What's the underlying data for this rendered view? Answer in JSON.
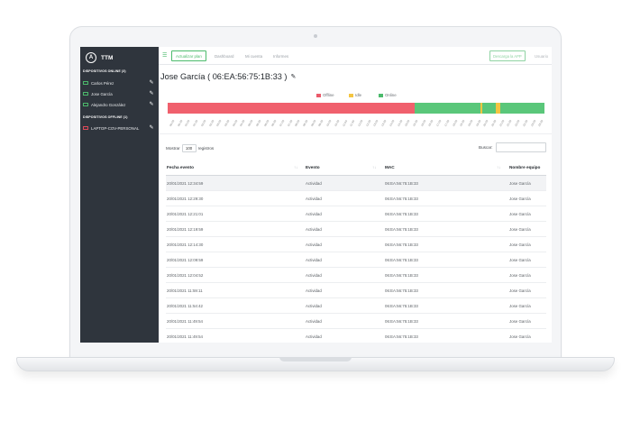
{
  "app": {
    "brand": "TTM",
    "brand_glyph": "A"
  },
  "sidebar": {
    "online_title": "DISPOSITIVOS ONLINE (3)",
    "offline_title": "DISPOSITIVOS OFFLINE (1)",
    "online_devices": [
      {
        "label": "Carlos Pérez"
      },
      {
        "label": "Jose García"
      },
      {
        "label": "Alejandro González"
      }
    ],
    "offline_devices": [
      {
        "label": "LAPTOP-COV-PERSONAL"
      }
    ]
  },
  "topbar": {
    "update_button": "Actualizar plan",
    "nav": [
      "Dashboard",
      "Mi cuenta",
      "Informes"
    ],
    "download_button": "Descarga la APP",
    "user_link": "Usuario"
  },
  "device": {
    "title": "Jose García ( 06:EA:56:75:1B:33 )"
  },
  "legend": {
    "items": [
      {
        "label": "Offline",
        "color": "#ea5a6a"
      },
      {
        "label": "Idle",
        "color": "#f4c542"
      },
      {
        "label": "Online",
        "color": "#4cbb6c"
      }
    ]
  },
  "timeline": {
    "segments": [
      {
        "state": "Offline",
        "fraction": 0.655,
        "color": "#f0606d"
      },
      {
        "state": "Online",
        "fraction": 0.175,
        "color": "#5ac77a"
      },
      {
        "state": "Idle",
        "fraction": 0.006,
        "color": "#f4c542"
      },
      {
        "state": "Online",
        "fraction": 0.034,
        "color": "#5ac77a"
      },
      {
        "state": "Idle",
        "fraction": 0.012,
        "color": "#f4c542"
      },
      {
        "state": "Online",
        "fraction": 0.118,
        "color": "#5ac77a"
      }
    ],
    "ticks": [
      "00:00",
      "00:30",
      "01:00",
      "01:30",
      "02:00",
      "02:30",
      "03:00",
      "03:30",
      "04:00",
      "04:30",
      "05:00",
      "05:30",
      "06:00",
      "06:30",
      "07:00",
      "07:30",
      "08:00",
      "08:30",
      "09:00",
      "09:30",
      "10:00",
      "10:30",
      "11:00",
      "11:30",
      "12:00",
      "12:30",
      "13:00",
      "13:30",
      "14:00",
      "14:30",
      "15:00",
      "15:30",
      "16:00",
      "16:30",
      "17:00",
      "17:30",
      "18:00",
      "18:30",
      "19:00",
      "19:30",
      "20:00",
      "20:30",
      "21:00",
      "21:30",
      "22:00",
      "22:30",
      "23:00",
      "23:30"
    ]
  },
  "table_controls": {
    "show_label": "Mostrar",
    "page_size": "100",
    "records_label": "registros",
    "search_label": "Buscar:",
    "search_value": ""
  },
  "table": {
    "columns": [
      "Fecha evento",
      "Evento",
      "MAC",
      "Nombre equipo"
    ],
    "rows": [
      [
        "20/01/2021 12:34:59",
        "Actividad",
        "06:EA:56:75:1B:33",
        "Jose García"
      ],
      [
        "20/01/2021 12:29:30",
        "Actividad",
        "06:EA:56:75:1B:33",
        "Jose García"
      ],
      [
        "20/01/2021 12:21:01",
        "Actividad",
        "06:EA:56:75:1B:33",
        "Jose García"
      ],
      [
        "20/01/2021 12:19:59",
        "Actividad",
        "06:EA:56:75:1B:33",
        "Jose García"
      ],
      [
        "20/01/2021 12:14:30",
        "Actividad",
        "06:EA:56:75:1B:33",
        "Jose García"
      ],
      [
        "20/01/2021 12:09:59",
        "Actividad",
        "06:EA:56:75:1B:33",
        "Jose García"
      ],
      [
        "20/01/2021 12:04:52",
        "Actividad",
        "06:EA:56:75:1B:33",
        "Jose García"
      ],
      [
        "20/01/2021 11:59:11",
        "Actividad",
        "06:EA:56:75:1B:33",
        "Jose García"
      ],
      [
        "20/01/2021 11:54:42",
        "Actividad",
        "06:EA:56:75:1B:33",
        "Jose García"
      ],
      [
        "20/01/2021 11:49:54",
        "Actividad",
        "06:EA:56:75:1B:33",
        "Jose García"
      ],
      [
        "20/01/2021 11:49:54",
        "Actividad",
        "06:EA:56:75:1B:33",
        "Jose García"
      ]
    ]
  },
  "icons": {
    "menu": "menu-icon",
    "edit": "pencil-icon",
    "device": "monitor-icon",
    "sort": "sort-icon"
  }
}
